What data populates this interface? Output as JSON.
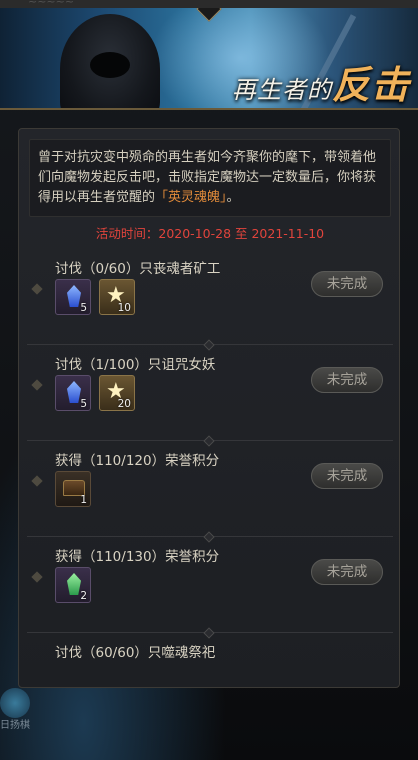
{
  "top_strip_text": "~~~~~",
  "banner": {
    "title_prefix": "再生者的",
    "title_big": "反击"
  },
  "intro": {
    "text_before": "曾于对抗灾变中殒命的再生者如今齐聚你的麾下，带领着他们向魔物发起反击吧，击败指定魔物达一定数量后，你将获得用以再生者觉醒的",
    "highlight": "「英灵魂魄」",
    "text_after": "。"
  },
  "date_line": "活动时间：2020-10-28 至 2021-11-10",
  "tasks": [
    {
      "label": "讨伐（0/60）只丧魂者矿工",
      "status": "未完成",
      "rewards": [
        {
          "icon": "blue-crystal-icon",
          "count": "5"
        },
        {
          "icon": "star-icon",
          "count": "10"
        }
      ]
    },
    {
      "label": "讨伐（1/100）只诅咒女妖",
      "status": "未完成",
      "rewards": [
        {
          "icon": "blue-crystal-icon",
          "count": "5"
        },
        {
          "icon": "star-icon",
          "count": "20"
        }
      ]
    },
    {
      "label": "获得（110/120）荣誉积分",
      "status": "未完成",
      "rewards": [
        {
          "icon": "chest-icon",
          "count": "1"
        }
      ]
    },
    {
      "label": "获得（110/130）荣誉积分",
      "status": "未完成",
      "rewards": [
        {
          "icon": "green-crystal-icon",
          "count": "2"
        }
      ]
    },
    {
      "label": "讨伐（60/60）只噬魂祭祀"
    }
  ],
  "bottom_label": "日扬棋"
}
